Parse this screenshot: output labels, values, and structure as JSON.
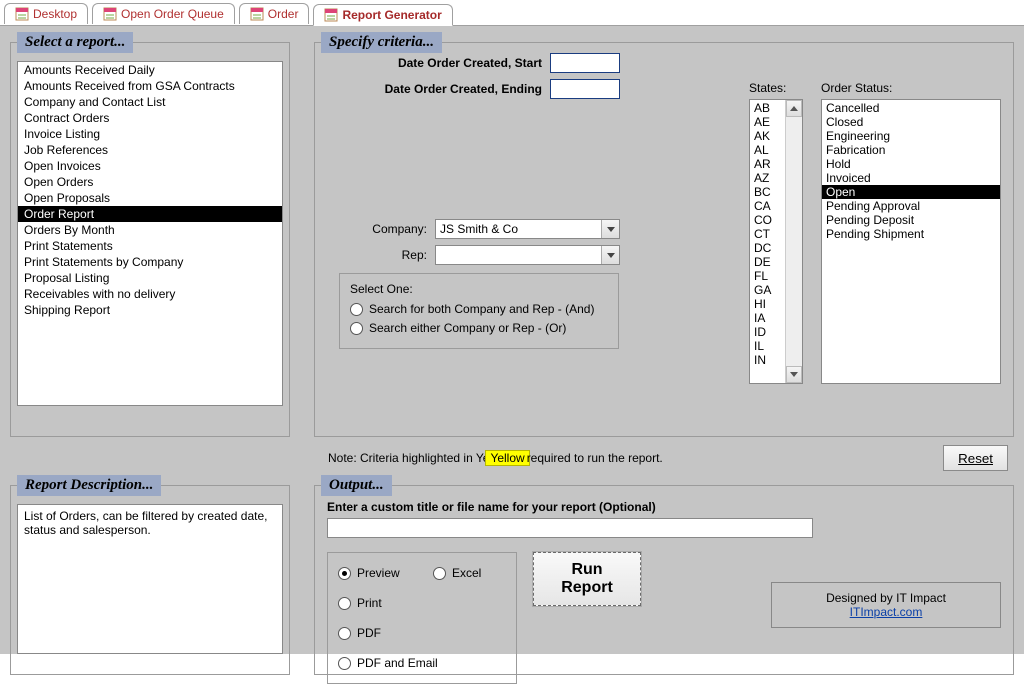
{
  "tabs": [
    {
      "label": "Desktop"
    },
    {
      "label": "Open Order Queue"
    },
    {
      "label": "Order"
    },
    {
      "label": "Report Generator"
    }
  ],
  "panels": {
    "select_report": "Select a report...",
    "criteria": "Specify criteria...",
    "description": "Report Description...",
    "output": "Output..."
  },
  "reports": [
    "Amounts Received Daily",
    "Amounts Received from GSA Contracts",
    "Company and Contact List",
    "Contract Orders",
    "Invoice Listing",
    "Job References",
    "Open Invoices",
    "Open Orders",
    "Open Proposals",
    "Order Report",
    "Orders By Month",
    "Print Statements",
    "Print Statements by Company",
    "Proposal Listing",
    "Receivables with no delivery",
    "Shipping Report"
  ],
  "selected_report_index": 9,
  "criteria": {
    "date_start_label": "Date Order Created, Start",
    "date_end_label": "Date Order Created, Ending",
    "company_label": "Company:",
    "rep_label": "Rep:",
    "company_value": "JS  Smith & Co",
    "rep_value": "",
    "states_label": "States:",
    "order_status_label": "Order Status:",
    "states": [
      "AB",
      "AE",
      "AK",
      "AL",
      "AR",
      "AZ",
      "BC",
      "CA",
      "CO",
      "CT",
      "DC",
      "DE",
      "FL",
      "GA",
      "HI",
      "IA",
      "ID",
      "IL",
      "IN"
    ],
    "statuses": [
      "Cancelled",
      "Closed",
      "Engineering",
      "Fabrication",
      "Hold",
      "Invoiced",
      "Open",
      "Pending Approval",
      "Pending Deposit",
      "Pending Shipment"
    ],
    "selected_status_index": 6,
    "select_one_title": "Select One:",
    "radio_and": "Search for both Company and Rep - (And)",
    "radio_or": "Search either Company or Rep - (Or)",
    "note_pre": "Note: Criteria highlighted in  Ye",
    "note_chip": "Yellow",
    "note_post": " required to run the report.",
    "reset": "Reset"
  },
  "description_text": "List of Orders, can be filtered by created date, status and salesperson.",
  "output": {
    "title_prompt": "Enter a custom title  or file name for your report (Optional)",
    "formats": {
      "preview": "Preview",
      "excel": "Excel",
      "print": "Print",
      "pdf": "PDF",
      "pdf_email": "PDF and Email"
    },
    "run_line1": "Run",
    "run_line2": "Report",
    "credit_line": "Designed by IT Impact",
    "credit_link": "ITImpact.com"
  }
}
